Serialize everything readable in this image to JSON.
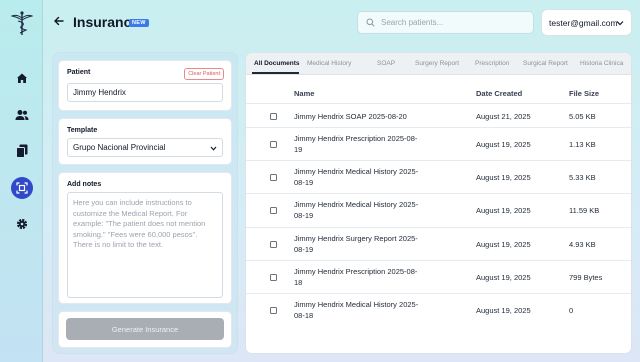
{
  "header": {
    "title": "Insurance",
    "badge": "NEW",
    "search_placeholder": "Search patients...",
    "user_email": "tester@gmail.com"
  },
  "sidebar": {
    "items": [
      {
        "icon": "home-icon"
      },
      {
        "icon": "users-icon"
      },
      {
        "icon": "documents-icon"
      },
      {
        "icon": "scan-icon",
        "active": true
      },
      {
        "icon": "gear-icon"
      }
    ],
    "accent": "#2f49c9"
  },
  "form": {
    "patient_label": "Patient",
    "clear_label": "Clear Patient",
    "patient_value": "Jimmy Hendrix",
    "template_label": "Template",
    "template_value": "Grupo Nacional Provincial",
    "notes_label": "Add notes",
    "notes_placeholder": "Here you can include instructions to customize the Medical Report. For example: \"The patient does not mention smoking.\" \"Fees were 60,000 pesos\". There is no limit to the text.",
    "generate_label": "Generate Insurance"
  },
  "tabs": [
    {
      "label": "All Documents",
      "active": true
    },
    {
      "label": "Medical History"
    },
    {
      "label": "SOAP"
    },
    {
      "label": "Surgery Report"
    },
    {
      "label": "Prescription"
    },
    {
      "label": "Surgical Report"
    },
    {
      "label": "Historia Clinica"
    }
  ],
  "table": {
    "headers": {
      "name": "Name",
      "date": "Date Created",
      "size": "File Size"
    },
    "rows": [
      {
        "name": "Jimmy Hendrix SOAP 2025-08-20",
        "date": "August 21, 2025",
        "size": "5.05 KB"
      },
      {
        "name": "Jimmy Hendrix Prescription 2025-08-19",
        "date": "August 19, 2025",
        "size": "1.13 KB"
      },
      {
        "name": "Jimmy Hendrix Medical History 2025-08-19",
        "date": "August 19, 2025",
        "size": "5.33 KB"
      },
      {
        "name": "Jimmy Hendrix Medical History 2025-08-19",
        "date": "August 19, 2025",
        "size": "11.59 KB"
      },
      {
        "name": "Jimmy Hendrix Surgery Report 2025-08-19",
        "date": "August 19, 2025",
        "size": "4.93 KB"
      },
      {
        "name": "Jimmy Hendrix Prescription 2025-08-18",
        "date": "August 19, 2025",
        "size": "799 Bytes"
      },
      {
        "name": "Jimmy Hendrix Medical History 2025-08-18",
        "date": "August 19, 2025",
        "size": "0"
      }
    ]
  }
}
